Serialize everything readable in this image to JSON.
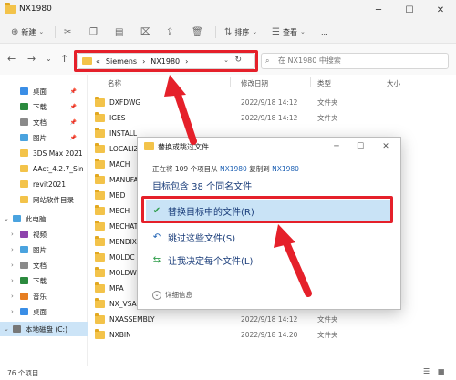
{
  "window": {
    "title": "NX1980",
    "minimize": "─",
    "maximize": "☐",
    "close": "✕"
  },
  "toolbar": {
    "new_label": "新建",
    "sort_label": "排序",
    "view_label": "查看",
    "more_label": "..."
  },
  "address": {
    "overflow": "«",
    "crumbs": [
      "Siemens",
      "NX1980"
    ],
    "separator": "›",
    "search_placeholder": "在 NX1980 中搜索"
  },
  "sidebar": {
    "items": [
      {
        "label": "桌面",
        "icon": "desktop-icon",
        "color": "#3a8ee6",
        "pinned": true
      },
      {
        "label": "下载",
        "icon": "download-icon",
        "color": "#2b8a3e",
        "pinned": true
      },
      {
        "label": "文档",
        "icon": "documents-icon",
        "color": "#8a8a8a",
        "pinned": true
      },
      {
        "label": "图片",
        "icon": "pictures-icon",
        "color": "#4aa3df",
        "pinned": true
      },
      {
        "label": "3DS Max 2021",
        "icon": "folder-icon",
        "color": "#f3c34a",
        "pinned": false
      },
      {
        "label": "AAct_4.2.7_Sin",
        "icon": "folder-icon",
        "color": "#f3c34a",
        "pinned": false
      },
      {
        "label": "revit2021",
        "icon": "folder-icon",
        "color": "#f3c34a",
        "pinned": false
      },
      {
        "label": "网站软件目录",
        "icon": "folder-icon",
        "color": "#f3c34a",
        "pinned": false
      },
      {
        "label": "此电脑",
        "icon": "computer-icon",
        "color": "#4aa3df",
        "pinned": false
      },
      {
        "label": "视频",
        "icon": "videos-icon",
        "color": "#8e44ad",
        "pinned": false
      },
      {
        "label": "图片",
        "icon": "pictures-icon",
        "color": "#4aa3df",
        "pinned": false
      },
      {
        "label": "文档",
        "icon": "documents-icon",
        "color": "#8a8a8a",
        "pinned": false
      },
      {
        "label": "下载",
        "icon": "download-icon",
        "color": "#2b8a3e",
        "pinned": false
      },
      {
        "label": "音乐",
        "icon": "music-icon",
        "color": "#e67e22",
        "pinned": false
      },
      {
        "label": "桌面",
        "icon": "desktop-icon",
        "color": "#3a8ee6",
        "pinned": false
      },
      {
        "label": "本地磁盘 (C:)",
        "icon": "drive-icon",
        "color": "#777777",
        "pinned": false
      }
    ]
  },
  "filelist": {
    "columns": {
      "name": "名称",
      "date": "修改日期",
      "type": "类型",
      "size": "大小"
    },
    "rows": [
      {
        "name": "DXFDWG",
        "date": "2022/9/18 14:12",
        "type": "文件夹"
      },
      {
        "name": "IGES",
        "date": "2022/9/18 14:12",
        "type": "文件夹"
      },
      {
        "name": "INSTALL",
        "date": "",
        "type": ""
      },
      {
        "name": "LOCALIZ",
        "date": "",
        "type": ""
      },
      {
        "name": "MACH",
        "date": "",
        "type": ""
      },
      {
        "name": "MANUFA",
        "date": "",
        "type": ""
      },
      {
        "name": "MBD",
        "date": "",
        "type": ""
      },
      {
        "name": "MECH",
        "date": "",
        "type": ""
      },
      {
        "name": "MECHAT",
        "date": "",
        "type": ""
      },
      {
        "name": "MENDIX",
        "date": "",
        "type": ""
      },
      {
        "name": "MOLDC",
        "date": "",
        "type": ""
      },
      {
        "name": "MOLDW",
        "date": "",
        "type": ""
      },
      {
        "name": "MPA",
        "date": "",
        "type": ""
      },
      {
        "name": "NX_VSA",
        "date": "2022/9/18 14:20",
        "type": "文件夹"
      },
      {
        "name": "NXASSEMBLY",
        "date": "2022/9/18 14:12",
        "type": "文件夹"
      },
      {
        "name": "NXBIN",
        "date": "2022/9/18 14:20",
        "type": "文件夹"
      }
    ]
  },
  "status": {
    "count": "76 个项目"
  },
  "dialog": {
    "title": "替换或跳过文件",
    "subtitle_prefix": "正在将 109 个项目从",
    "source": "NX1980",
    "copy_word": "复制到",
    "dest": "NX1980",
    "heading": "目标包含 38 个同名文件",
    "options": [
      {
        "label": "替换目标中的文件(R)",
        "icon": "checkmark-icon",
        "glyph": "✔",
        "color": "#2e9d4a"
      },
      {
        "label": "跳过这些文件(S)",
        "icon": "skip-icon",
        "glyph": "↶",
        "color": "#1b5fb3"
      },
      {
        "label": "让我决定每个文件(L)",
        "icon": "decide-icon",
        "glyph": "⇆",
        "color": "#2e9d4a"
      }
    ],
    "details_label": "详细信息"
  },
  "colors": {
    "highlight": "#e5202a",
    "option_active": "#c9e3f6"
  }
}
